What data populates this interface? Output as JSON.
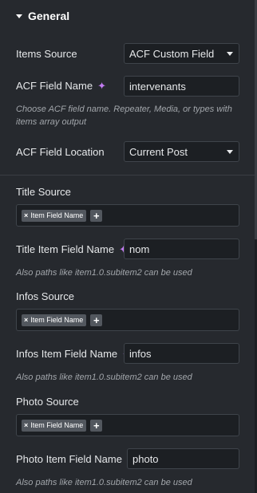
{
  "section": {
    "title": "General"
  },
  "items_source": {
    "label": "Items Source",
    "value": "ACF Custom Field"
  },
  "acf_field_name": {
    "label": "ACF Field Name",
    "value": "intervenants",
    "help": "Choose ACF field name. Repeater, Media, or types with items array output"
  },
  "acf_field_location": {
    "label": "ACF Field Location",
    "value": "Current Post"
  },
  "title_source": {
    "label": "Title Source",
    "tag": "Item Field Name",
    "add": "+"
  },
  "title_item_field": {
    "label": "Title Item Field Name",
    "value": "nom",
    "help": "Also paths like item1.0.subitem2 can be used"
  },
  "infos_source": {
    "label": "Infos Source",
    "tag": "Item Field Name",
    "add": "+"
  },
  "infos_item_field": {
    "label": "Infos Item Field Name",
    "value": "infos",
    "help": "Also paths like item1.0.subitem2 can be used"
  },
  "photo_source": {
    "label": "Photo Source",
    "tag": "Item Field Name",
    "add": "+"
  },
  "photo_item_field": {
    "label": "Photo Item Field Name",
    "value": "photo",
    "help": "Also paths like item1.0.subitem2 can be used"
  },
  "icons": {
    "ai": "sparkle-icon",
    "remove": "close-icon",
    "caret": "caret-down-icon",
    "chevron": "chevron-down-icon"
  },
  "colors": {
    "background": "#26292e",
    "field": "#1c1f23",
    "ai_accent": "#c27bf2",
    "tag": "#52575e"
  }
}
